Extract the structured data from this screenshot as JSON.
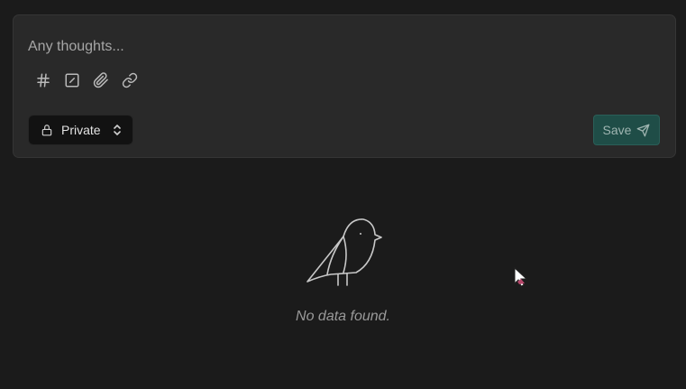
{
  "editor": {
    "placeholder": "Any thoughts...",
    "toolbar": [
      {
        "name": "tag-button",
        "icon": "hash-icon"
      },
      {
        "name": "todo-button",
        "icon": "checkbox-icon"
      },
      {
        "name": "attachment-button",
        "icon": "paperclip-icon"
      },
      {
        "name": "link-button",
        "icon": "link-icon"
      }
    ],
    "visibility": {
      "label": "Private",
      "icon": "lock-icon",
      "chevron_icon": "chevrons-up-down-icon"
    },
    "save": {
      "label": "Save",
      "icon": "send-icon"
    }
  },
  "empty_state": {
    "icon": "bird-icon",
    "message": "No data found."
  },
  "colors": {
    "background": "#1b1b1b",
    "editor_background": "#292929",
    "save_button": "#1f4d47",
    "visibility_background": "#121212"
  }
}
